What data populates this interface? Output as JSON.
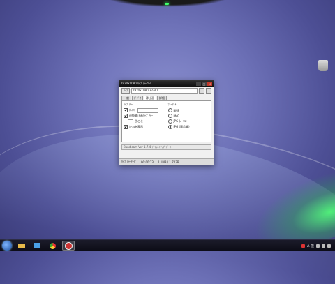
{
  "window": {
    "title": "1920x1080 ｷｬﾌﾟﾁｬｰﾂｰﾙ",
    "min_btn": "—",
    "max_btn": "□",
    "close_btn": "×"
  },
  "toolbar": {
    "settings_label": "ｿｰｽ",
    "resolution_text": "1920x1080 32-BIT",
    "rec_btn": "■"
  },
  "tabs": [
    "一般",
    "ﾋﾞﾃﾞｵ",
    "静止画",
    "詳細"
  ],
  "active_tab_index": 2,
  "left_group": {
    "label": "ｷｬﾌﾟﾁｬｰ",
    "options": [
      {
        "label": "ﾎｯﾄｷｰ",
        "checked": true
      },
      {
        "label": "連続静止画ｷｬﾌﾟﾁｬｰ",
        "checked": true
      },
      {
        "label": "秒ごと",
        "checked": false
      },
      {
        "label": "ｶｰｿﾙを表示",
        "checked": true
      }
    ]
  },
  "right_group": {
    "label": "ﾌｫｰﾏｯﾄ",
    "options": [
      {
        "label": "BMP",
        "selected": false
      },
      {
        "label": "PNG",
        "selected": false
      },
      {
        "label": "JPG (ﾉｰﾏﾙ)",
        "selected": false
      },
      {
        "label": "JPG (高品質)",
        "selected": true
      }
    ]
  },
  "info_bar": "Bandicam Ver 1.7.4 ﾃﾞﾌｫﾙﾄｱｯﾌﾟﾃﾞｰﾄ",
  "status": {
    "mode": "ｷｬﾌﾟﾁｬｰﾓｰﾄﾞ",
    "time": "00:00:13",
    "size": "1.1MB / 1.727B"
  },
  "taskbar": {
    "items": [
      "explorer",
      "media",
      "chrome",
      "bandicam"
    ],
    "tray_lang": "A 般"
  }
}
